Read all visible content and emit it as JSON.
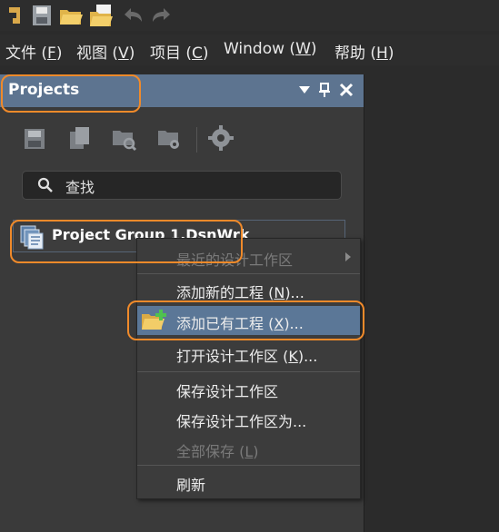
{
  "toolbar": {
    "icons": [
      "app-logo-icon",
      "save-all-icon",
      "open-folder-icon",
      "open-document-icon",
      "undo-icon",
      "redo-icon"
    ]
  },
  "menubar": {
    "items": [
      {
        "label": "文件 (",
        "key": "F",
        "end": ")"
      },
      {
        "label": "视图 (",
        "key": "V",
        "end": ")"
      },
      {
        "label": "项目 (",
        "key": "C",
        "end": ")"
      },
      {
        "label": "Window (",
        "key": "W",
        "end": ")"
      },
      {
        "label": "帮助 (",
        "key": "H",
        "end": ")"
      }
    ]
  },
  "panel": {
    "title": "Projects",
    "header_icons": [
      "dropdown-icon",
      "pin-icon",
      "close-icon"
    ],
    "search": {
      "placeholder": "查找"
    },
    "tree": {
      "item_label": "Project Group 1.DsnWrk"
    }
  },
  "context_menu": {
    "items": [
      {
        "label": "最近的设计工作区",
        "key": "",
        "end": "",
        "disabled": true,
        "submenu": true
      },
      {
        "label": "添加新的工程 (",
        "key": "N",
        "end": ")...",
        "disabled": false
      },
      {
        "label": "添加已有工程 (",
        "key": "X",
        "end": ")...",
        "disabled": false,
        "hover": true
      },
      {
        "label": "打开设计工作区 (",
        "key": "K",
        "end": ")...",
        "disabled": false
      },
      {
        "label": "保存设计工作区",
        "key": "",
        "end": "",
        "disabled": false
      },
      {
        "label": "保存设计工作区为...",
        "key": "",
        "end": "",
        "disabled": false
      },
      {
        "label": "全部保存 (",
        "key": "L",
        "end": ")",
        "disabled": true
      },
      {
        "label": "刷新",
        "key": "",
        "end": "",
        "disabled": false
      }
    ]
  },
  "colors": {
    "accent": "#5d7490",
    "highlight": "#f08a2a",
    "menu_hover": "#5b7797"
  }
}
